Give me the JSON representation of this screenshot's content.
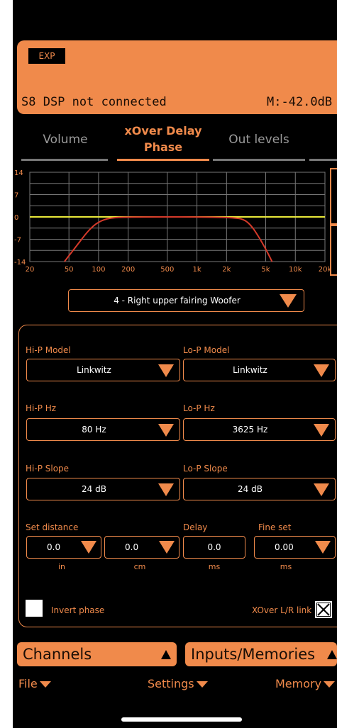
{
  "header": {
    "exp_label": "EXP",
    "status": "S8 DSP not connected",
    "meter": "M:-42.0dB"
  },
  "tabs": [
    {
      "label": "Volume",
      "active": false
    },
    {
      "label": "xOver Delay Phase",
      "line1": "xOver Delay",
      "line2": "Phase",
      "active": true
    },
    {
      "label": "Out levels",
      "active": false
    }
  ],
  "chart_data": {
    "type": "line",
    "y_ticks": [
      "14",
      "7",
      "0",
      "-7",
      "-14"
    ],
    "x_ticks": [
      "20",
      "50",
      "100",
      "200",
      "500",
      "1k",
      "2k",
      "5k",
      "10k",
      "20k"
    ],
    "xscale": "log",
    "ylim": [
      -14,
      14
    ],
    "xlim": [
      20,
      20000
    ],
    "grid": true,
    "series": [
      {
        "color": "#e9e93a",
        "points": [
          [
            20,
            0
          ],
          [
            20000,
            0
          ]
        ]
      },
      {
        "color": "#d63a2a",
        "points": [
          [
            45,
            -14
          ],
          [
            60,
            -9
          ],
          [
            80,
            -4
          ],
          [
            100,
            -1.5
          ],
          [
            130,
            -0.3
          ],
          [
            200,
            0
          ],
          [
            1000,
            0
          ],
          [
            2500,
            -0.2
          ],
          [
            3100,
            -1
          ],
          [
            3625,
            -3
          ],
          [
            4200,
            -6
          ],
          [
            5000,
            -10
          ],
          [
            5800,
            -14
          ]
        ]
      }
    ]
  },
  "channel_select": {
    "value": "4 - Right upper fairing Woofer"
  },
  "settings": {
    "hip_model_label": "Hi-P Model",
    "hip_model_value": "Linkwitz",
    "lop_model_label": "Lo-P Model",
    "lop_model_value": "Linkwitz",
    "hip_hz_label": "Hi-P Hz",
    "hip_hz_value": "80 Hz",
    "lop_hz_label": "Lo-P Hz",
    "lop_hz_value": "3625 Hz",
    "hip_slope_label": "Hi-P Slope",
    "hip_slope_value": "24 dB",
    "lop_slope_label": "Lo-P Slope",
    "lop_slope_value": "24 dB",
    "distance_label": "Set distance",
    "delay_label": "Delay",
    "fine_label": "Fine set",
    "dist_in_value": "0.0",
    "dist_in_unit": "in",
    "dist_cm_value": "0.0",
    "dist_cm_unit": "cm",
    "delay_value": "0.0",
    "delay_unit": "ms",
    "fine_value": "0.00",
    "fine_unit": "ms",
    "invert_label": "Invert phase",
    "invert_checked": false,
    "link_label": "XOver L/R link",
    "link_checked": true
  },
  "bottom": {
    "channels_label": "Channels",
    "inputs_label": "Inputs/Memories",
    "file_label": "File",
    "settings_label": "Settings",
    "memory_label": "Memory"
  },
  "colors": {
    "accent": "#f08a4b",
    "background": "#000000"
  }
}
